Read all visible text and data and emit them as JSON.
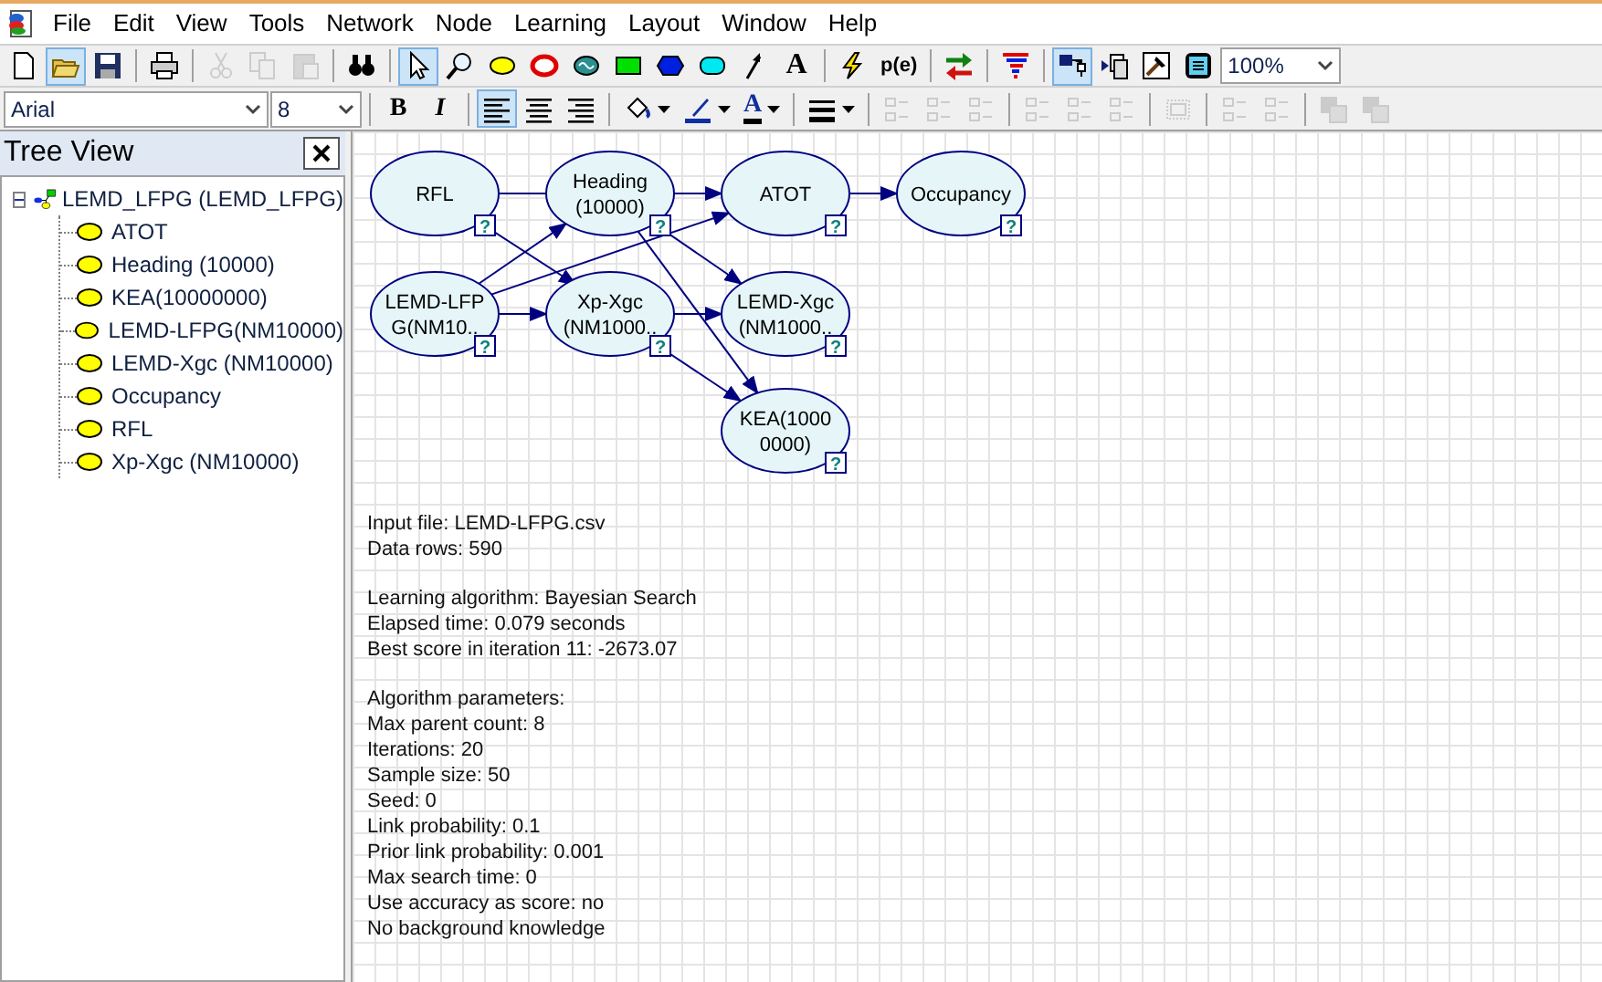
{
  "menu": [
    "File",
    "Edit",
    "View",
    "Tools",
    "Network",
    "Node",
    "Learning",
    "Layout",
    "Window",
    "Help"
  ],
  "toolbar_1": [
    {
      "kind": "new",
      "pressed": false,
      "disabled": false
    },
    {
      "kind": "open",
      "pressed": true,
      "disabled": false
    },
    {
      "kind": "save",
      "pressed": false,
      "disabled": false
    },
    {
      "kind": "sep"
    },
    {
      "kind": "print",
      "pressed": false,
      "disabled": false
    },
    {
      "kind": "sep"
    },
    {
      "kind": "cut",
      "pressed": false,
      "disabled": true
    },
    {
      "kind": "copy",
      "pressed": false,
      "disabled": true
    },
    {
      "kind": "paste",
      "pressed": false,
      "disabled": true
    },
    {
      "kind": "sep"
    },
    {
      "kind": "find",
      "pressed": false,
      "disabled": false
    },
    {
      "kind": "sep"
    },
    {
      "kind": "pointer",
      "pressed": true,
      "disabled": false
    },
    {
      "kind": "zoom",
      "pressed": false,
      "disabled": false
    },
    {
      "kind": "chance",
      "pressed": false,
      "disabled": false
    },
    {
      "kind": "deterministic",
      "pressed": false,
      "disabled": false
    },
    {
      "kind": "equation",
      "pressed": false,
      "disabled": false
    },
    {
      "kind": "decision",
      "pressed": false,
      "disabled": false
    },
    {
      "kind": "utility",
      "pressed": false,
      "disabled": false
    },
    {
      "kind": "mau",
      "pressed": false,
      "disabled": false
    },
    {
      "kind": "arc",
      "pressed": false,
      "disabled": false
    },
    {
      "kind": "text",
      "label": "A",
      "pressed": false,
      "disabled": false
    },
    {
      "kind": "sep"
    },
    {
      "kind": "update",
      "pressed": false,
      "disabled": false
    },
    {
      "kind": "evidence",
      "label": "p(e)",
      "pressed": false,
      "disabled": false
    },
    {
      "kind": "sep"
    },
    {
      "kind": "swap",
      "pressed": false,
      "disabled": false
    },
    {
      "kind": "sep"
    },
    {
      "kind": "filter",
      "pressed": false,
      "disabled": false
    },
    {
      "kind": "sep"
    },
    {
      "kind": "graph-view",
      "pressed": true,
      "disabled": false
    },
    {
      "kind": "copy-view",
      "pressed": false,
      "disabled": false
    },
    {
      "kind": "hammer",
      "pressed": false,
      "disabled": false
    },
    {
      "kind": "screen",
      "pressed": false,
      "disabled": false
    },
    {
      "kind": "select",
      "value": "100%"
    }
  ],
  "toolbar_2": [
    {
      "kind": "font-select",
      "value": "Arial"
    },
    {
      "kind": "size-select",
      "value": "8"
    },
    {
      "kind": "sep"
    },
    {
      "kind": "bold",
      "label": "B",
      "pressed": false,
      "disabled": false
    },
    {
      "kind": "italic",
      "label": "I",
      "pressed": false,
      "disabled": false
    },
    {
      "kind": "sep"
    },
    {
      "kind": "align-left",
      "pressed": true,
      "disabled": false
    },
    {
      "kind": "align-center",
      "pressed": false,
      "disabled": false
    },
    {
      "kind": "align-right",
      "pressed": false,
      "disabled": false
    },
    {
      "kind": "sep"
    },
    {
      "kind": "fill-color",
      "pressed": false,
      "disabled": false
    },
    {
      "kind": "line-color",
      "pressed": false,
      "disabled": false
    },
    {
      "kind": "font-color",
      "label": "A",
      "pressed": false,
      "disabled": false
    },
    {
      "kind": "sep"
    },
    {
      "kind": "line-width",
      "pressed": false,
      "disabled": false
    },
    {
      "kind": "sep"
    },
    {
      "kind": "align-nodes-left",
      "pressed": false,
      "disabled": true
    },
    {
      "kind": "align-nodes-right",
      "pressed": false,
      "disabled": true
    },
    {
      "kind": "align-nodes-center",
      "pressed": false,
      "disabled": true
    },
    {
      "kind": "sep"
    },
    {
      "kind": "align-nodes-top",
      "pressed": false,
      "disabled": true
    },
    {
      "kind": "align-nodes-bottom",
      "pressed": false,
      "disabled": true
    },
    {
      "kind": "align-nodes-middle",
      "pressed": false,
      "disabled": true
    },
    {
      "kind": "sep"
    },
    {
      "kind": "fit",
      "pressed": false,
      "disabled": true
    },
    {
      "kind": "sep"
    },
    {
      "kind": "distribute-h",
      "pressed": false,
      "disabled": true
    },
    {
      "kind": "distribute-v",
      "pressed": false,
      "disabled": true
    },
    {
      "kind": "sep"
    },
    {
      "kind": "bring-front",
      "pressed": false,
      "disabled": true
    },
    {
      "kind": "send-back",
      "pressed": false,
      "disabled": true
    }
  ],
  "tree_view": {
    "title": "Tree View",
    "root": {
      "label": "LEMD_LFPG (LEMD_LFPG)",
      "expanded": true,
      "children": [
        {
          "label": "ATOT"
        },
        {
          "label": "Heading (10000)"
        },
        {
          "label": "KEA(10000000)"
        },
        {
          "label": "LEMD-LFPG(NM10000)"
        },
        {
          "label": "LEMD-Xgc (NM10000)"
        },
        {
          "label": "Occupancy"
        },
        {
          "label": "RFL"
        },
        {
          "label": "Xp-Xgc (NM10000)"
        }
      ]
    }
  },
  "network": {
    "nodes": [
      {
        "lines": [
          "RFL"
        ]
      },
      {
        "lines": [
          "Heading",
          "(10000)"
        ]
      },
      {
        "lines": [
          "ATOT"
        ]
      },
      {
        "lines": [
          "Occupancy"
        ]
      },
      {
        "lines": [
          "LEMD-LFP",
          "G(NM10.."
        ]
      },
      {
        "lines": [
          "Xp-Xgc",
          "(NM1000.."
        ]
      },
      {
        "lines": [
          "LEMD-Xgc",
          "(NM1000.."
        ]
      },
      {
        "lines": [
          "KEA(1000",
          "0000)"
        ]
      }
    ],
    "node_badge": "?"
  },
  "report": [
    [
      "Input file: LEMD-LFPG.csv",
      "Data rows: 590"
    ],
    [
      "Learning algorithm: Bayesian Search",
      "Elapsed time: 0.079 seconds",
      "Best score in iteration 11: -2673.07"
    ],
    [
      "Algorithm parameters:",
      "Max parent count: 8",
      "Iterations: 20",
      "Sample size: 50",
      "Seed: 0",
      "Link probability: 0.1",
      "Prior link probability: 0.001",
      "Max search time: 0",
      "Use accuracy as score: no",
      "No background knowledge"
    ]
  ]
}
